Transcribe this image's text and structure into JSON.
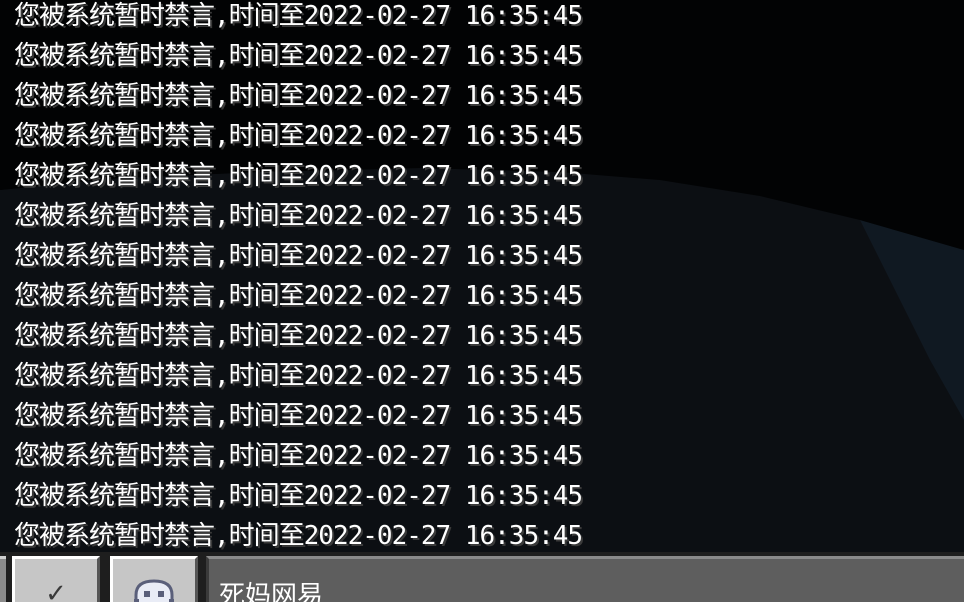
{
  "chat": {
    "messages": [
      "您被系统暂时禁言,时间至2022-02-27 16:35:45",
      "您被系统暂时禁言,时间至2022-02-27 16:35:45",
      "您被系统暂时禁言,时间至2022-02-27 16:35:45",
      "您被系统暂时禁言,时间至2022-02-27 16:35:45",
      "您被系统暂时禁言,时间至2022-02-27 16:35:45",
      "您被系统暂时禁言,时间至2022-02-27 16:35:45",
      "您被系统暂时禁言,时间至2022-02-27 16:35:45",
      "您被系统暂时禁言,时间至2022-02-27 16:35:45",
      "您被系统暂时禁言,时间至2022-02-27 16:35:45",
      "您被系统暂时禁言,时间至2022-02-27 16:35:45",
      "您被系统暂时禁言,时间至2022-02-27 16:35:45",
      "您被系统暂时禁言,时间至2022-02-27 16:35:45",
      "您被系统暂时禁言,时间至2022-02-27 16:35:45",
      "您被系统暂时禁言,时间至2022-02-27 16:35:45"
    ],
    "text_color": "#ffffff"
  },
  "bar": {
    "check_icon": "checkmark-icon",
    "check_glyph": "✓",
    "emote_icon": "emote-face-icon",
    "input_value": "死妈网易"
  }
}
